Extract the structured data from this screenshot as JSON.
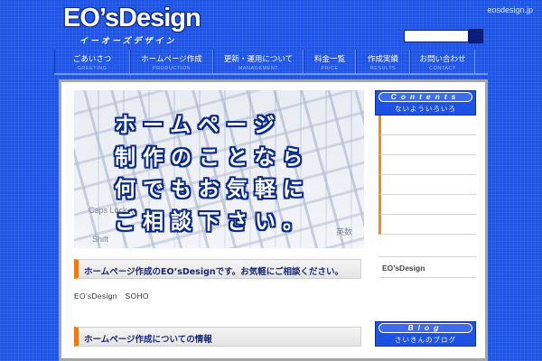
{
  "header": {
    "logo_text": "EO’sDesign",
    "logo_sub": "イーオーズデザイン",
    "domain": "eosdesign.jp"
  },
  "search": {
    "placeholder": ""
  },
  "nav": {
    "items": [
      {
        "ja": "ごあいさつ",
        "en": "GREETING"
      },
      {
        "ja": "ホームページ作成",
        "en": "PRODUCTION"
      },
      {
        "ja": "更新・運用について",
        "en": "MANAGEMENT"
      },
      {
        "ja": "料金一覧",
        "en": "PRICE"
      },
      {
        "ja": "作成実績",
        "en": "RESULTS"
      },
      {
        "ja": "お問い合わせ",
        "en": "CONTACT"
      }
    ]
  },
  "hero": {
    "lines": [
      "ホームページ",
      "制作のことなら",
      "何でもお気軽に",
      "ご相談下さい。"
    ],
    "key_labels": [
      "Caps Lock",
      "Shift",
      "英数"
    ]
  },
  "main": {
    "section1_heading": "ホームページ作成のEO’sDesignです。お気軽にご相談ください。",
    "body": "EO’sDesign　SOHO",
    "section2_heading": "ホームページ作成についての情報"
  },
  "sidebar": {
    "contents_title": "Contents",
    "contents_sub": "ないよういろいろ",
    "item_count": 6,
    "label": "EO’sDesign",
    "blog_title": "Blog",
    "blog_sub": "さいきんのブログ"
  },
  "colors": {
    "background": "#1f55e6",
    "accent": "#f07a10",
    "heading_text": "#1a2a78"
  }
}
